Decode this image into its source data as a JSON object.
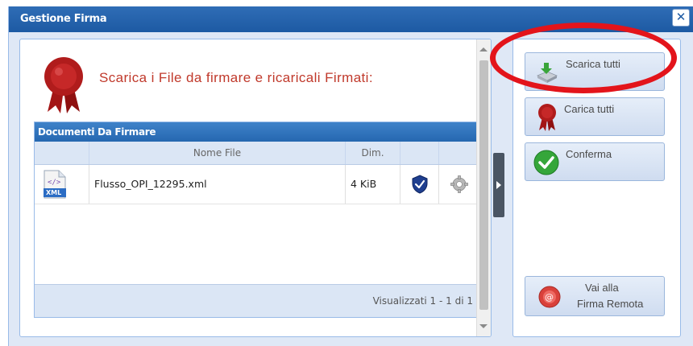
{
  "window": {
    "title": "Gestione Firma",
    "close_glyph": "✕"
  },
  "header": {
    "text": "Scarica i File da firmare e ricaricali Firmati:",
    "icon": "red-seal-icon"
  },
  "grid": {
    "title": "Documenti Da Firmare",
    "columns": [
      "",
      "Nome File",
      "Dim.",
      "",
      ""
    ],
    "rows": [
      {
        "file_type": "XML",
        "name": "Flusso_OPI_12295.xml",
        "size": "4 KiB",
        "actions": [
          "shield-icon",
          "gear-icon"
        ]
      }
    ],
    "paging": "Visualizzati 1 - 1 di 1"
  },
  "actions": {
    "download_all": "Scarica tutti",
    "upload_all": "Carica tutti",
    "confirm": "Conferma",
    "remote_sign_line1": "Vai alla",
    "remote_sign_line2": "Firma Remota"
  },
  "colors": {
    "accent": "#1d5aa3",
    "highlight": "#e3141b",
    "header_text": "#c0392b"
  }
}
